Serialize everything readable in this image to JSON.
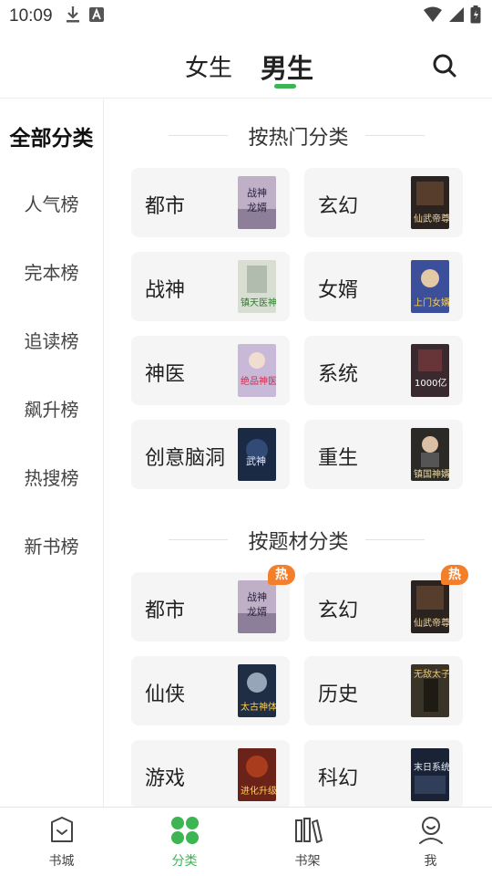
{
  "status_bar": {
    "time": "10:09"
  },
  "header": {
    "tabs": [
      {
        "label": "女生",
        "active": false
      },
      {
        "label": "男生",
        "active": true
      }
    ],
    "accent_color": "#3cb552"
  },
  "sidebar": {
    "items": [
      {
        "label": "全部分类",
        "active": true
      },
      {
        "label": "人气榜"
      },
      {
        "label": "完本榜"
      },
      {
        "label": "追读榜"
      },
      {
        "label": "飙升榜"
      },
      {
        "label": "热搜榜"
      },
      {
        "label": "新书榜"
      }
    ]
  },
  "sections": [
    {
      "title": "按热门分类",
      "cards": [
        {
          "name": "都市",
          "cover_text": "战神龙婿",
          "cover_color": "#bfb0c7"
        },
        {
          "name": "玄幻",
          "cover_text": "仙武帝尊",
          "cover_color": "#2a2320"
        },
        {
          "name": "战神",
          "cover_text": "镇天医神",
          "cover_color": "#d8ded2"
        },
        {
          "name": "女婿",
          "cover_text": "上门女婿",
          "cover_color": "#3b4f9a"
        },
        {
          "name": "神医",
          "cover_text": "绝品神医",
          "cover_color": "#c9b9d8"
        },
        {
          "name": "系统",
          "cover_text": "1000亿",
          "cover_color": "#3a2a30"
        },
        {
          "name": "创意脑洞",
          "cover_text": "武神",
          "cover_color": "#1b2a44"
        },
        {
          "name": "重生",
          "cover_text": "镇国神婿",
          "cover_color": "#2c2a26"
        }
      ]
    },
    {
      "title": "按题材分类",
      "cards": [
        {
          "name": "都市",
          "cover_text": "战神龙婿",
          "cover_color": "#bfb0c7",
          "badge": "热"
        },
        {
          "name": "玄幻",
          "cover_text": "仙武帝尊",
          "cover_color": "#2a2320",
          "badge": "热"
        },
        {
          "name": "仙侠",
          "cover_text": "太古神体",
          "cover_color": "#1f2d45"
        },
        {
          "name": "历史",
          "cover_text": "无敌太子",
          "cover_color": "#3a3328"
        },
        {
          "name": "游戏",
          "cover_text": "进化升级",
          "cover_color": "#6b2218"
        },
        {
          "name": "科幻",
          "cover_text": "末日系统",
          "cover_color": "#1a2236"
        }
      ]
    }
  ],
  "bottom_nav": [
    {
      "label": "书城",
      "icon": "bookstore-icon",
      "active": false
    },
    {
      "label": "分类",
      "icon": "category-icon",
      "active": true
    },
    {
      "label": "书架",
      "icon": "bookshelf-icon",
      "active": false
    },
    {
      "label": "我",
      "icon": "profile-icon",
      "active": false
    }
  ]
}
